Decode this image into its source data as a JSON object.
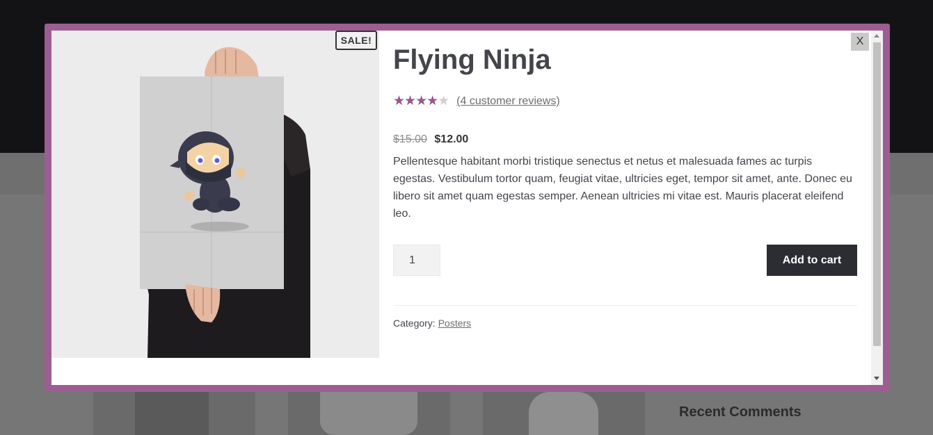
{
  "product": {
    "sale_badge": "SALE!",
    "title": "Flying Ninja",
    "rating": 4,
    "rating_max": 5,
    "stars_text": "★★★★★",
    "reviews_link": "(4 customer reviews)",
    "price_old": "$15.00",
    "price_new": "$12.00",
    "description": "Pellentesque habitant morbi tristique senectus et netus et malesuada fames ac turpis egestas. Vestibulum tortor quam, feugiat vitae, ultricies eget, tempor sit amet, ante. Donec eu libero sit amet quam egestas semper. Aenean ultricies mi vitae est. Mauris placerat eleifend leo.",
    "quantity": "1",
    "add_to_cart_label": "Add to cart",
    "category_label": "Category:",
    "category_value": "Posters"
  },
  "modal": {
    "close_label": "X"
  },
  "background": {
    "widget_title": "Recent Comments"
  },
  "colors": {
    "accent": "#96588a",
    "modal_border": "#9c5e92",
    "button": "#2c2d33"
  }
}
